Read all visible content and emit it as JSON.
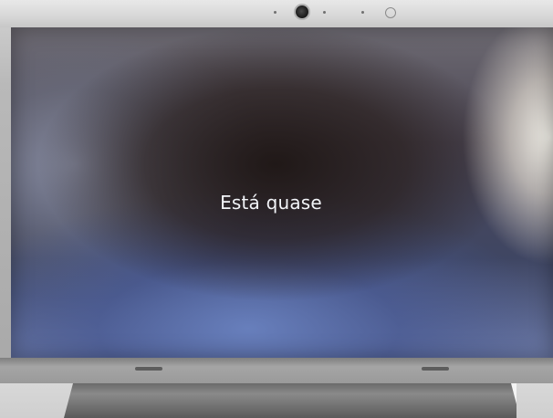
{
  "screen": {
    "status_text": "Está quase"
  }
}
